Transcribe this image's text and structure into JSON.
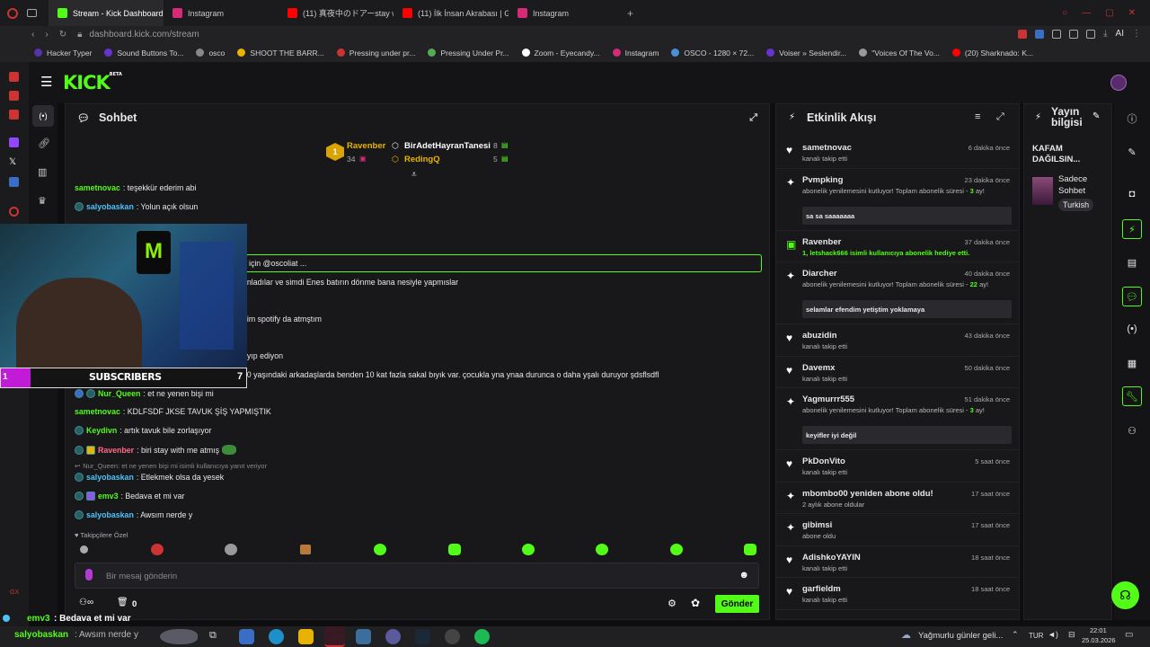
{
  "browser": {
    "tabs": [
      {
        "label": "Stream - Kick Dashboard",
        "color": "#53fc18"
      },
      {
        "label": "Instagram",
        "color": "#d62976"
      },
      {
        "label": "(11) 真夜中のドアーstay with",
        "color": "#ff0000"
      },
      {
        "label": "(11) İlk İnsan Akrabası | Gl",
        "color": "#ff0000"
      },
      {
        "label": "Instagram",
        "color": "#d62976"
      }
    ],
    "new_tab": "+",
    "url": "dashboard.kick.com/stream",
    "bookmarks": [
      "Hacker Typer",
      "Sound Buttons To...",
      "osco",
      "SHOOT THE BARR...",
      "Pressing under pr...",
      "Pressing Under Pr...",
      "Zoom - Eyecandy...",
      "Instagram",
      "OSCO - 1280 × 72...",
      "Voiser » Seslendir...",
      "\"Voices Of The Vo...",
      "(20) Sharknado: K..."
    ],
    "ai_label": "AI"
  },
  "kick": {
    "logo": "KICK",
    "logo_sup": "BETA"
  },
  "chat": {
    "title": "Sohbet",
    "leaderboard": [
      {
        "rank": "1",
        "name": "Ravenber",
        "value": "34"
      },
      {
        "name": "BirAdetHayranTanesi",
        "value": "8"
      },
      {
        "name": "RedingQ",
        "value": "5"
      }
    ],
    "pinned_text": "için @oscoliat ...",
    "messages": [
      {
        "user": "sametnovac",
        "text": ": teşekkür ederim abi",
        "color": "#53fc18"
      },
      {
        "user": "salyobaskan",
        "text": ": Yolun açık olsun",
        "color": "#4fc3f7"
      },
      {
        "user": "",
        "text": "anladılar ve simdi Enes batırın dönme bana nesiyle yapmıslar",
        "color": "#fff"
      },
      {
        "user": "",
        "text": "nim spotify da atmştım",
        "color": "#fff"
      },
      {
        "user": "",
        "text": "ayıp ediyon",
        "color": "#fff"
      },
      {
        "user": "",
        "text": "ya: osco 27 yaşındayım 20 yaşındaki arkadaşlarda benden 10 kat fazla sakal bıyık var. çocukla yna ynaa durunca o daha yşalı duruyor şdsflsdfl",
        "color": "#fff"
      },
      {
        "user": "Nur_Queen",
        "text": ": et ne yenen bişi mi",
        "color": "#53fc18"
      },
      {
        "user": "sametnovac",
        "text": ": KDLFSDF JKSE TAVUK ŞİŞ YAPMIŞTIK",
        "color": "#53fc18"
      },
      {
        "user": "Keydivn",
        "text": ": artık tavuk bile zorlaşıyor",
        "color": "#53fc18"
      },
      {
        "user": "Ravenber",
        "text": ": biri stay with me atmış",
        "color": "#ff6b8a"
      },
      {
        "user": "",
        "text": "Nur_Queen: et ne yenen bişi mi isimli kullanıcıya yanıt veriyor",
        "color": "#8a8a8a"
      },
      {
        "user": "salyobaskan",
        "text": ": Etlekmek olsa da yesek",
        "color": "#4fc3f7"
      },
      {
        "user": "emv3",
        "text": ": Bedava et mi var",
        "color": "#53fc18"
      },
      {
        "user": "salyobaskan",
        "text": ": Awsım nerde y",
        "color": "#4fc3f7"
      }
    ],
    "emote_label": "Takipçilere Özel",
    "input_placeholder": "Bir mesaj gönderin",
    "stat_1": "0",
    "send_label": "Gönder"
  },
  "webcam": {
    "overlay_count": "1",
    "subs_label": "SUBSCRIBERS",
    "subs_count": "7"
  },
  "activity": {
    "title": "Etkinlik Akışı",
    "items": [
      {
        "name": "sametnovac",
        "sub": "kanalı takip etti",
        "time": "6 dakika önce",
        "icon": "heart"
      },
      {
        "name": "Pvmpking",
        "sub": "abonelik yenilemesini kutluyor! Toplam abonelik süresi - ",
        "sub_num": "3",
        "sub_end": "ay!",
        "time": "23 dakika önce",
        "icon": "star",
        "note": "sa sa saaaaaaa"
      },
      {
        "name": "Ravenber",
        "sub": "1, letshack666 isimli kullanıcıya abonelik hediye etti.",
        "time": "37 dakika önce",
        "icon": "gift"
      },
      {
        "name": "Diarcher",
        "sub": "abonelik yenilemesini kutluyor! Toplam abonelik süresi - ",
        "sub_num": "22",
        "sub_end": "ay!",
        "time": "40 dakika önce",
        "icon": "star",
        "note": "selamlar efendim yetiştim yoklamaya"
      },
      {
        "name": "abuzidin",
        "sub": "kanalı takip etti",
        "time": "43 dakika önce",
        "icon": "heart"
      },
      {
        "name": "Davemx",
        "sub": "kanalı takip etti",
        "time": "50 dakika önce",
        "icon": "heart"
      },
      {
        "name": "Yagmurrr555",
        "sub": "abonelik yenilemesini kutluyor! Toplam abonelik süresi - ",
        "sub_num": "3",
        "sub_end": "ay!",
        "time": "51 dakika önce",
        "icon": "star",
        "note": "keyifler iyi değil"
      },
      {
        "name": "PkDonVito",
        "sub": "kanalı takip etti",
        "time": "5 saat önce",
        "icon": "heart"
      },
      {
        "name": "mbombo00 yeniden abone oldu!",
        "sub": "2 aylık abone oldular",
        "time": "17 saat önce",
        "icon": "star"
      },
      {
        "name": "gibimsi",
        "sub": "abone oldu",
        "time": "17 saat önce",
        "icon": "star"
      },
      {
        "name": "AdishkoYAYIN",
        "sub": "kanalı takip etti",
        "time": "18 saat önce",
        "icon": "heart"
      },
      {
        "name": "garfieldm",
        "sub": "kanalı takip etti",
        "time": "18 saat önce",
        "icon": "heart"
      }
    ]
  },
  "stream_info": {
    "title": "Yayın bilgisi",
    "stream_title": "KAFAM DAĞILSIN...",
    "category": "Sadece Sohbet",
    "language": "Turkish"
  },
  "taskbar": {
    "overlay_user": "emv3",
    "overlay_text": ": Bedava et mi var",
    "overlay_user2": "salyobaskan",
    "overlay_text2": ": Awsım nerde y",
    "weather": "Yağmurlu günler geli...",
    "lang": "TUR",
    "time": "22:01",
    "date": "25.03.2026"
  }
}
